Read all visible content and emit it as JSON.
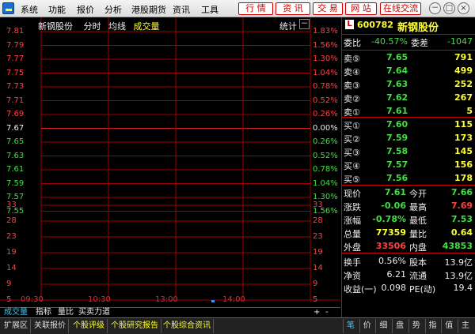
{
  "menu": {
    "items": [
      "系统",
      "功能",
      "报价",
      "分析",
      "港股期货",
      "资讯",
      "工具"
    ],
    "right_buttons": [
      "行  情",
      "资  讯",
      "交  易",
      "网  站",
      "在线交流"
    ],
    "window_controls": [
      "－",
      "□",
      "×"
    ]
  },
  "chart": {
    "stock_name": "新钢股份",
    "tab_fenshi": "分时",
    "tab_junxian": "均线",
    "tab_chengjiao": "成交量",
    "stats_label": "统计",
    "button_minus": "－",
    "price_labels": [
      "7.81",
      "7.79",
      "7.77",
      "7.75",
      "7.73",
      "7.71",
      "7.69",
      "7.67",
      "7.65",
      "7.63",
      "7.61",
      "7.59",
      "7.57",
      "7.55"
    ],
    "pct_labels": [
      "1.83%",
      "1.56%",
      "1.30%",
      "1.04%",
      "0.78%",
      "0.52%",
      "0.26%",
      "0.00%",
      "0.26%",
      "0.52%",
      "0.78%",
      "1.04%",
      "1.30%",
      "1.56%"
    ],
    "volume_labels": [
      "33",
      "28",
      "23",
      "19",
      "14",
      "9",
      "5"
    ],
    "time_labels": [
      "09:30",
      "10:30",
      "13:00",
      "14:00"
    ],
    "colors": {
      "grid": "#a00000",
      "up": "#ff4040",
      "down": "#40e040",
      "flat": "#eeeeee",
      "volume_bar": "#3399ff"
    }
  },
  "chart_data": {
    "type": "line",
    "title": "新钢股份",
    "x": [
      "09:30",
      "10:30",
      "13:00",
      "14:00"
    ],
    "series": [],
    "ylim": [
      7.55,
      7.81
    ],
    "volume": {
      "x": "13:45",
      "value": 5
    }
  },
  "tabs": {
    "indicators": [
      "成交量",
      "指标",
      "量比",
      "买卖力道"
    ],
    "scroll": [
      "+",
      "-"
    ]
  },
  "bottom": {
    "tabs": [
      "扩展区",
      "关联报价",
      "个股评级",
      "个股研究报告",
      "个股综合资讯"
    ],
    "right_tabs": [
      "笔",
      "价",
      "细",
      "盘",
      "势",
      "指",
      "值",
      "主"
    ]
  },
  "quote": {
    "badge": "L",
    "code": "600782",
    "name": "新钢股份",
    "weibi_label": "委比",
    "weibi": "-40.57%",
    "weicha_label": "委差",
    "weicha": "-1047",
    "sells": [
      {
        "label": "卖⑤",
        "price": "7.65",
        "vol": "791"
      },
      {
        "label": "卖④",
        "price": "7.64",
        "vol": "499"
      },
      {
        "label": "卖③",
        "price": "7.63",
        "vol": "252"
      },
      {
        "label": "卖②",
        "price": "7.62",
        "vol": "267"
      },
      {
        "label": "卖①",
        "price": "7.61",
        "vol": "5"
      }
    ],
    "buys": [
      {
        "label": "买①",
        "price": "7.60",
        "vol": "115"
      },
      {
        "label": "买②",
        "price": "7.59",
        "vol": "173"
      },
      {
        "label": "买③",
        "price": "7.58",
        "vol": "145"
      },
      {
        "label": "买④",
        "price": "7.57",
        "vol": "156"
      },
      {
        "label": "买⑤",
        "price": "7.56",
        "vol": "178"
      }
    ],
    "stats": [
      {
        "l1": "现价",
        "v1": "7.61",
        "l2": "今开",
        "v2": "7.66"
      },
      {
        "l1": "涨跌",
        "v1": "-0.06",
        "l2": "最高",
        "v2": "7.69"
      },
      {
        "l1": "涨幅",
        "v1": "-0.78%",
        "l2": "最低",
        "v2": "7.53"
      },
      {
        "l1": "总量",
        "v1": "77359",
        "l2": "量比",
        "v2": "0.64"
      },
      {
        "l1": "外盘",
        "v1": "33506",
        "l2": "内盘",
        "v2": "43853"
      }
    ],
    "extra": [
      {
        "l1": "换手",
        "v1": "0.56%",
        "l2": "股本",
        "v2": "13.9亿"
      },
      {
        "l1": "净资",
        "v1": "6.21",
        "l2": "流通",
        "v2": "13.9亿"
      },
      {
        "l1": "收益(一)",
        "v1": "0.098",
        "l2": "PE(动)",
        "v2": "19.4"
      }
    ]
  }
}
